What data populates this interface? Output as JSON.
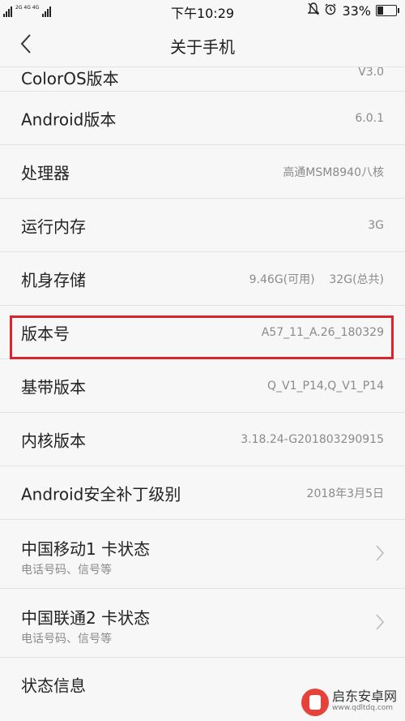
{
  "status_bar": {
    "network_label": "2G 4G 4G",
    "time": "下午10:29",
    "battery_text": "33%",
    "battery_level": 0.33,
    "icons": [
      "mute-icon",
      "alarm-icon",
      "battery-charging-icon"
    ]
  },
  "nav": {
    "title": "关于手机",
    "back_icon": "chevron-left-icon"
  },
  "rows": [
    {
      "label": "ColorOS版本",
      "value": "V3.0"
    },
    {
      "label": "Android版本",
      "value": "6.0.1"
    },
    {
      "label": "处理器",
      "value": "高通MSM8940八核"
    },
    {
      "label": "运行内存",
      "value": "3G"
    },
    {
      "label": "机身存储",
      "value": "9.46G(可用)    32G(总共)"
    },
    {
      "label": "版本号",
      "value": "A57_11_A.26_180329"
    },
    {
      "label": "基带版本",
      "value": "Q_V1_P14,Q_V1_P14"
    },
    {
      "label": "内核版本",
      "value": "3.18.24-G201803290915"
    },
    {
      "label": "Android安全补丁级别",
      "value": "2018年3月5日"
    }
  ],
  "sim_rows": [
    {
      "label": "中国移动1 卡状态",
      "sub": "电话号码、信号等"
    },
    {
      "label": "中国联通2 卡状态",
      "sub": "电话号码、信号等"
    }
  ],
  "last_row": {
    "label": "状态信息"
  },
  "watermark": {
    "name": "启东安卓网",
    "url": "www.qdltdq.com"
  },
  "colors": {
    "highlight": "#d8252e",
    "background": "#f7f7f7",
    "secondary_text": "#8a8a8a"
  }
}
